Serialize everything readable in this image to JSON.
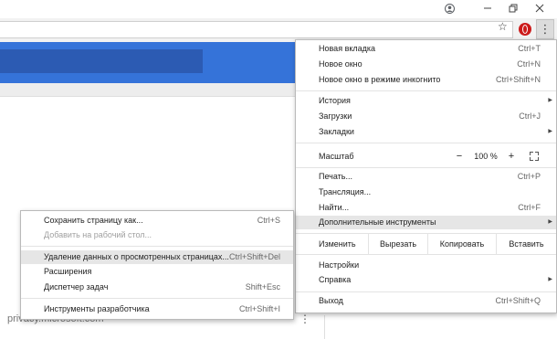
{
  "window": {
    "icons": {
      "account": "account-icon",
      "restore": "restore-icon",
      "close": "close-icon"
    }
  },
  "toolbar": {
    "icons": {
      "bookmark": "star-icon",
      "extension": "opera-extension-icon",
      "menu": "kebab-menu-icon"
    }
  },
  "page": {
    "url_text": "privacy.microsoft.com",
    "accent": "#3573d9"
  },
  "main_menu": {
    "items": {
      "new_tab": {
        "label": "Новая вкладка",
        "shortcut": "Ctrl+T"
      },
      "new_window": {
        "label": "Новое окно",
        "shortcut": "Ctrl+N"
      },
      "incognito": {
        "label": "Новое окно в режиме инкогнито",
        "shortcut": "Ctrl+Shift+N"
      },
      "history": {
        "label": "История"
      },
      "downloads": {
        "label": "Загрузки",
        "shortcut": "Ctrl+J"
      },
      "bookmarks": {
        "label": "Закладки"
      },
      "zoom": {
        "label": "Масштаб",
        "minus": "−",
        "value": "100 %",
        "plus": "+"
      },
      "print": {
        "label": "Печать...",
        "shortcut": "Ctrl+P"
      },
      "cast": {
        "label": "Трансляция..."
      },
      "find": {
        "label": "Найти...",
        "shortcut": "Ctrl+F"
      },
      "more_tools": {
        "label": "Дополнительные инструменты"
      },
      "edit": {
        "label": "Изменить",
        "cut": "Вырезать",
        "copy": "Копировать",
        "paste": "Вставить"
      },
      "settings": {
        "label": "Настройки"
      },
      "help": {
        "label": "Справка"
      },
      "exit": {
        "label": "Выход",
        "shortcut": "Ctrl+Shift+Q"
      }
    }
  },
  "sub_menu": {
    "items": {
      "save_page": {
        "label": "Сохранить страницу как...",
        "shortcut": "Ctrl+S"
      },
      "add_desktop": {
        "label": "Добавить на рабочий стол..."
      },
      "clear_data": {
        "label": "Удаление данных о просмотренных страницах...",
        "shortcut": "Ctrl+Shift+Del"
      },
      "extensions": {
        "label": "Расширения"
      },
      "task_manager": {
        "label": "Диспетчер задач",
        "shortcut": "Shift+Esc"
      },
      "dev_tools": {
        "label": "Инструменты разработчика",
        "shortcut": "Ctrl+Shift+I"
      }
    }
  }
}
